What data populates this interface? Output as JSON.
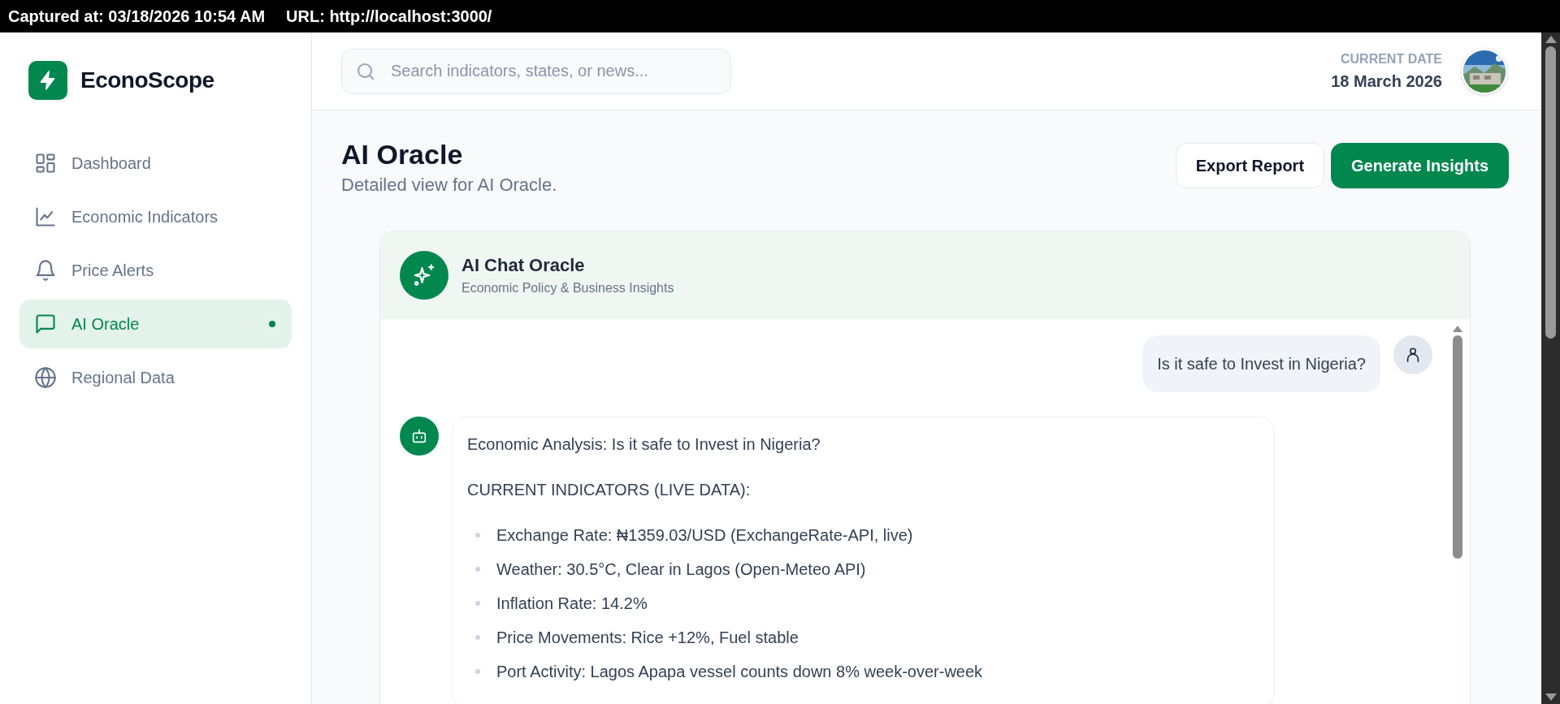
{
  "capture_bar": {
    "captured": "Captured at: 03/18/2026 10:54 AM",
    "url": "URL: http://localhost:3000/"
  },
  "sidebar": {
    "brand": "EconoScope",
    "items": [
      {
        "label": "Dashboard",
        "selected": false
      },
      {
        "label": "Economic Indicators",
        "selected": false
      },
      {
        "label": "Price Alerts",
        "selected": false
      },
      {
        "label": "AI Oracle",
        "selected": true
      },
      {
        "label": "Regional Data",
        "selected": false
      }
    ]
  },
  "header": {
    "search": {
      "placeholder": "Search indicators, states, or news..."
    },
    "date_label": "CURRENT DATE",
    "date": "18 March 2026"
  },
  "page": {
    "title": "AI Oracle",
    "subtitle": "Detailed view for AI Oracle.",
    "buttons": [
      {
        "label": "Export Report",
        "kind": "secondary"
      },
      {
        "label": "Generate Insights",
        "kind": "primary"
      }
    ]
  },
  "chat": {
    "title": "AI Chat Oracle",
    "subtitle": "Economic Policy & Business Insights",
    "messages": [
      {
        "kind": "user",
        "blocks": [
          {
            "kind": "paragraph",
            "text": "Is it safe to Invest in Nigeria?"
          }
        ]
      },
      {
        "kind": "assistant",
        "blocks": [
          {
            "kind": "paragraph",
            "text": "Economic Analysis: Is it safe to Invest in Nigeria?"
          },
          {
            "kind": "paragraph",
            "text": "CURRENT INDICATORS (LIVE DATA):"
          },
          {
            "kind": "list",
            "items": [
              "Exchange Rate: ₦1359.03/USD (ExchangeRate-API, live)",
              "Weather: 30.5°C, Clear in Lagos (Open-Meteo API)",
              "Inflation Rate: 14.2%",
              "Price Movements: Rice +12%, Fuel stable",
              "Port Activity: Lagos Apapa vessel counts down 8% week-over-week"
            ]
          }
        ]
      }
    ]
  }
}
